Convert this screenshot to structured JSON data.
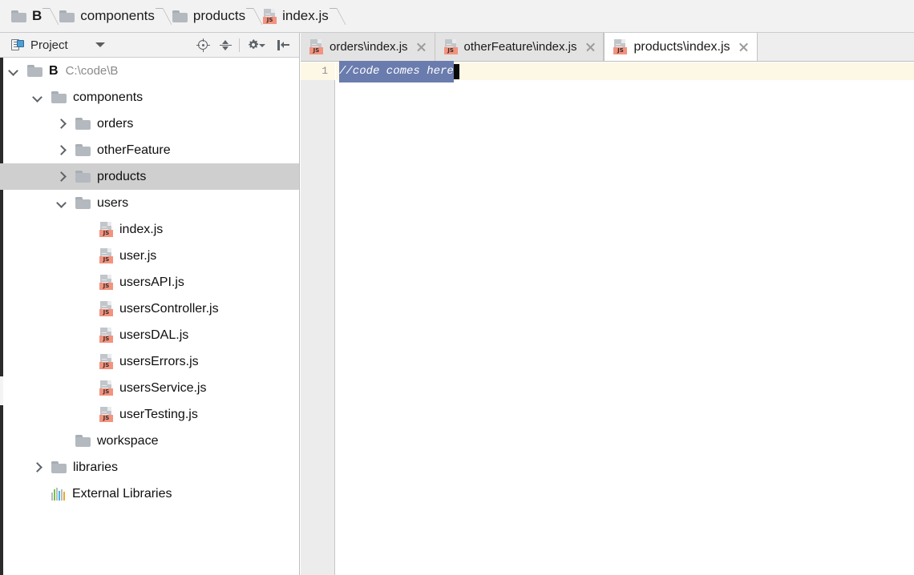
{
  "breadcrumb": {
    "name": "breadcrumb",
    "items": [
      {
        "label": "B",
        "icon": "folder-icon",
        "bold": true
      },
      {
        "label": "components",
        "icon": "folder-icon",
        "bold": false
      },
      {
        "label": "products",
        "icon": "folder-icon",
        "bold": false
      },
      {
        "label": "index.js",
        "icon": "js-file-icon",
        "bold": false
      }
    ]
  },
  "sidebar": {
    "toolbar": {
      "panel_icon": "project-panel-icon",
      "title": "Project",
      "dropdown_icon": "chevron-down-icon",
      "buttons": [
        {
          "name": "locate-in-tree-button",
          "icon": "locate-icon"
        },
        {
          "name": "collapse-all-button",
          "icon": "collapse-all-icon"
        },
        {
          "name": "settings-button",
          "icon": "gear-icon"
        },
        {
          "name": "hide-panel-button",
          "icon": "hide-panel-icon"
        }
      ]
    },
    "tree": [
      {
        "label": "B",
        "path": "C:\\code\\B",
        "icon": "folder-icon",
        "twisty": "down",
        "indent": 0,
        "bold": true,
        "selected": false
      },
      {
        "label": "components",
        "path": "",
        "icon": "folder-icon",
        "twisty": "down",
        "indent": 1,
        "bold": false,
        "selected": false
      },
      {
        "label": "orders",
        "path": "",
        "icon": "folder-icon",
        "twisty": "right",
        "indent": 2,
        "bold": false,
        "selected": false
      },
      {
        "label": "otherFeature",
        "path": "",
        "icon": "folder-icon",
        "twisty": "right",
        "indent": 2,
        "bold": false,
        "selected": false
      },
      {
        "label": "products",
        "path": "",
        "icon": "folder-icon",
        "twisty": "right",
        "indent": 2,
        "bold": false,
        "selected": true
      },
      {
        "label": "users",
        "path": "",
        "icon": "folder-icon",
        "twisty": "down",
        "indent": 2,
        "bold": false,
        "selected": false
      },
      {
        "label": "index.js",
        "path": "",
        "icon": "js-file-icon",
        "twisty": "none",
        "indent": 3,
        "bold": false,
        "selected": false
      },
      {
        "label": "user.js",
        "path": "",
        "icon": "js-file-icon",
        "twisty": "none",
        "indent": 3,
        "bold": false,
        "selected": false
      },
      {
        "label": "usersAPI.js",
        "path": "",
        "icon": "js-file-icon",
        "twisty": "none",
        "indent": 3,
        "bold": false,
        "selected": false
      },
      {
        "label": "usersController.js",
        "path": "",
        "icon": "js-file-icon",
        "twisty": "none",
        "indent": 3,
        "bold": false,
        "selected": false
      },
      {
        "label": "usersDAL.js",
        "path": "",
        "icon": "js-file-icon",
        "twisty": "none",
        "indent": 3,
        "bold": false,
        "selected": false
      },
      {
        "label": "usersErrors.js",
        "path": "",
        "icon": "js-file-icon",
        "twisty": "none",
        "indent": 3,
        "bold": false,
        "selected": false
      },
      {
        "label": "usersService.js",
        "path": "",
        "icon": "js-file-icon",
        "twisty": "none",
        "indent": 3,
        "bold": false,
        "selected": false
      },
      {
        "label": "userTesting.js",
        "path": "",
        "icon": "js-file-icon",
        "twisty": "none",
        "indent": 3,
        "bold": false,
        "selected": false
      },
      {
        "label": "workspace",
        "path": "",
        "icon": "folder-icon",
        "twisty": "none",
        "indent": 2,
        "bold": false,
        "selected": false
      },
      {
        "label": "libraries",
        "path": "",
        "icon": "folder-icon",
        "twisty": "right",
        "indent": 1,
        "bold": false,
        "selected": false
      },
      {
        "label": "External Libraries",
        "path": "",
        "icon": "external-libraries-icon",
        "twisty": "none",
        "indent": 1,
        "bold": false,
        "selected": false
      }
    ]
  },
  "editor": {
    "tabs": [
      {
        "label": "orders\\index.js",
        "icon": "js-file-icon",
        "active": false,
        "close_icon": "close-icon"
      },
      {
        "label": "otherFeature\\index.js",
        "icon": "js-file-icon",
        "active": false,
        "close_icon": "close-icon"
      },
      {
        "label": "products\\index.js",
        "icon": "js-file-icon",
        "active": true,
        "close_icon": "close-icon"
      }
    ],
    "line_numbers": [
      "1"
    ],
    "code": {
      "text": "//code comes here",
      "selected": true
    }
  },
  "colors": {
    "accent_js_badge": "#f2937f",
    "selection": "#6a7cae",
    "current_line": "#fdf8e6",
    "tree_selected": "#cfcfcf",
    "folder": "#b3b9bf"
  }
}
